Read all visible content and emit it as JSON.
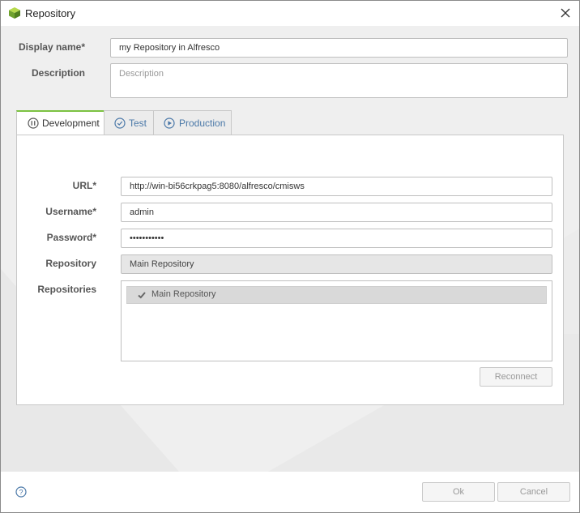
{
  "window": {
    "title": "Repository"
  },
  "form": {
    "display_name_label": "Display name*",
    "display_name_value": "my Repository in Alfresco",
    "description_label": "Description",
    "description_placeholder": "Description"
  },
  "tabs": [
    {
      "label": "Development",
      "icon": "pause-circle-icon",
      "active": true
    },
    {
      "label": "Test",
      "icon": "check-circle-icon",
      "active": false
    },
    {
      "label": "Production",
      "icon": "play-circle-icon",
      "active": false
    }
  ],
  "connection": {
    "url_label": "URL*",
    "url_value": "http://win-bi56crkpag5:8080/alfresco/cmisws",
    "username_label": "Username*",
    "username_value": "admin",
    "password_label": "Password*",
    "password_value": "•••••••••••",
    "repository_label": "Repository",
    "repository_value": "Main Repository",
    "repositories_label": "Repositories",
    "repositories": [
      {
        "label": "Main Repository",
        "checked": true
      }
    ],
    "reconnect_label": "Reconnect"
  },
  "footer": {
    "ok_label": "Ok",
    "cancel_label": "Cancel"
  },
  "colors": {
    "accent": "#7cc242",
    "link": "#4a78a8"
  }
}
